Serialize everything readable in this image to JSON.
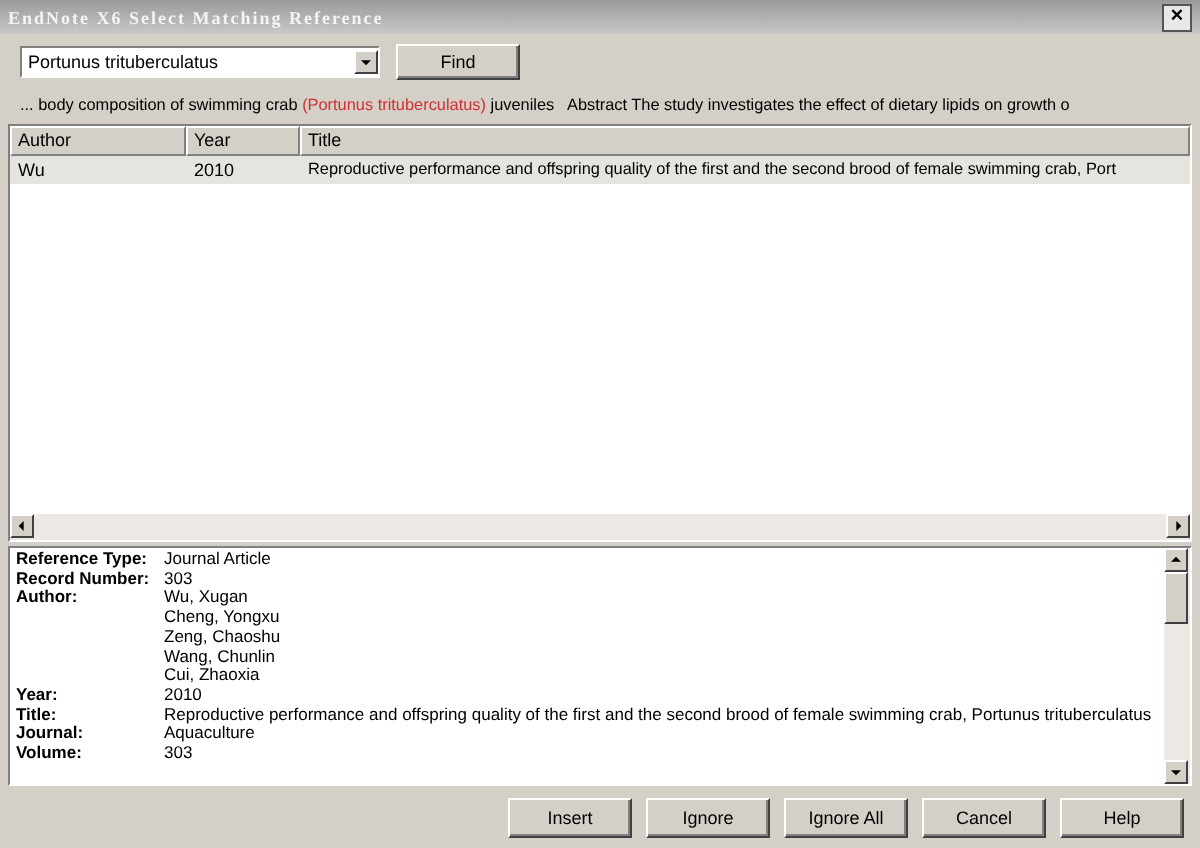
{
  "window": {
    "title": "EndNote X6 Select Matching Reference",
    "close": "×"
  },
  "search": {
    "value": "Portunus trituberculatus",
    "find_button": "Find"
  },
  "snippet": [
    {
      "text": "... body composition of swimming crab ",
      "highlight": false
    },
    {
      "text": "(Portunus trituberculatus)",
      "highlight": true
    },
    {
      "text": " juveniles   Abstract The study investigates the effect of dietary lipids on growth o",
      "highlight": false
    }
  ],
  "table": {
    "columns": [
      "Author",
      "Year",
      "Title"
    ],
    "rows": [
      {
        "cells": [
          "Wu",
          "2010",
          "Reproductive performance and offspring quality of the first and the second brood of female swimming crab, Port"
        ],
        "selected": true
      }
    ]
  },
  "details": [
    {
      "label": "Reference Type:",
      "lines": [
        "Journal Article"
      ]
    },
    {
      "label": "Record Number:",
      "lines": [
        "303"
      ]
    },
    {
      "label": "Author:",
      "lines": [
        "Wu, Xugan",
        "Cheng, Yongxu",
        "Zeng, Chaoshu",
        "Wang, Chunlin",
        "Cui, Zhaoxia"
      ]
    },
    {
      "label": "Year:",
      "lines": [
        "2010"
      ]
    },
    {
      "label": "Title:",
      "lines": [
        "Reproductive performance and offspring quality of the first and the second brood of female swimming crab, Portunus trituberculatus"
      ]
    },
    {
      "label": "Journal:",
      "lines": [
        "Aquaculture"
      ]
    },
    {
      "label": "Volume:",
      "lines": [
        "303"
      ]
    }
  ],
  "buttons": [
    "Insert",
    "Ignore",
    "Ignore All",
    "Cancel",
    "Help"
  ]
}
